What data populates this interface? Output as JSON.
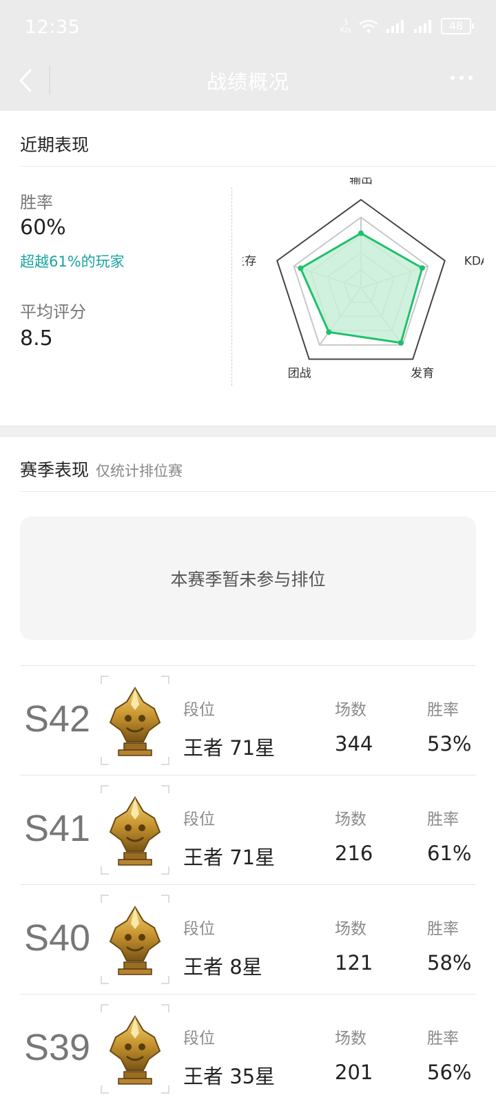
{
  "status_bar": {
    "time": "12:35",
    "net_speed_top": "3",
    "net_speed_bottom": "K/s",
    "battery": "48"
  },
  "header": {
    "title": "战绩概况"
  },
  "recent": {
    "title": "近期表现",
    "win_rate_label": "胜率",
    "win_rate_value": "60%",
    "win_rate_note": "超越61%的玩家",
    "avg_score_label": "平均评分",
    "avg_score_value": "8.5",
    "radar": {
      "axes": [
        "输出",
        "KDA",
        "发育",
        "团战",
        "生存"
      ],
      "values": [
        0.62,
        0.73,
        0.77,
        0.62,
        0.72
      ],
      "fill_color": "#c8efd8",
      "stroke_color": "#1fc06b"
    }
  },
  "season": {
    "title": "赛季表现",
    "subtitle": "仅统计排位赛",
    "empty_text": "本赛季暂未参与排位",
    "column_labels": {
      "rank": "段位",
      "games": "场数",
      "win_rate": "胜率"
    },
    "rows": [
      {
        "season": "S42",
        "rank": "王者 71星",
        "games": "344",
        "win_rate": "53%"
      },
      {
        "season": "S41",
        "rank": "王者 71星",
        "games": "216",
        "win_rate": "61%"
      },
      {
        "season": "S40",
        "rank": "王者 8星",
        "games": "121",
        "win_rate": "58%"
      },
      {
        "season": "S39",
        "rank": "王者 35星",
        "games": "201",
        "win_rate": "56%"
      }
    ]
  }
}
